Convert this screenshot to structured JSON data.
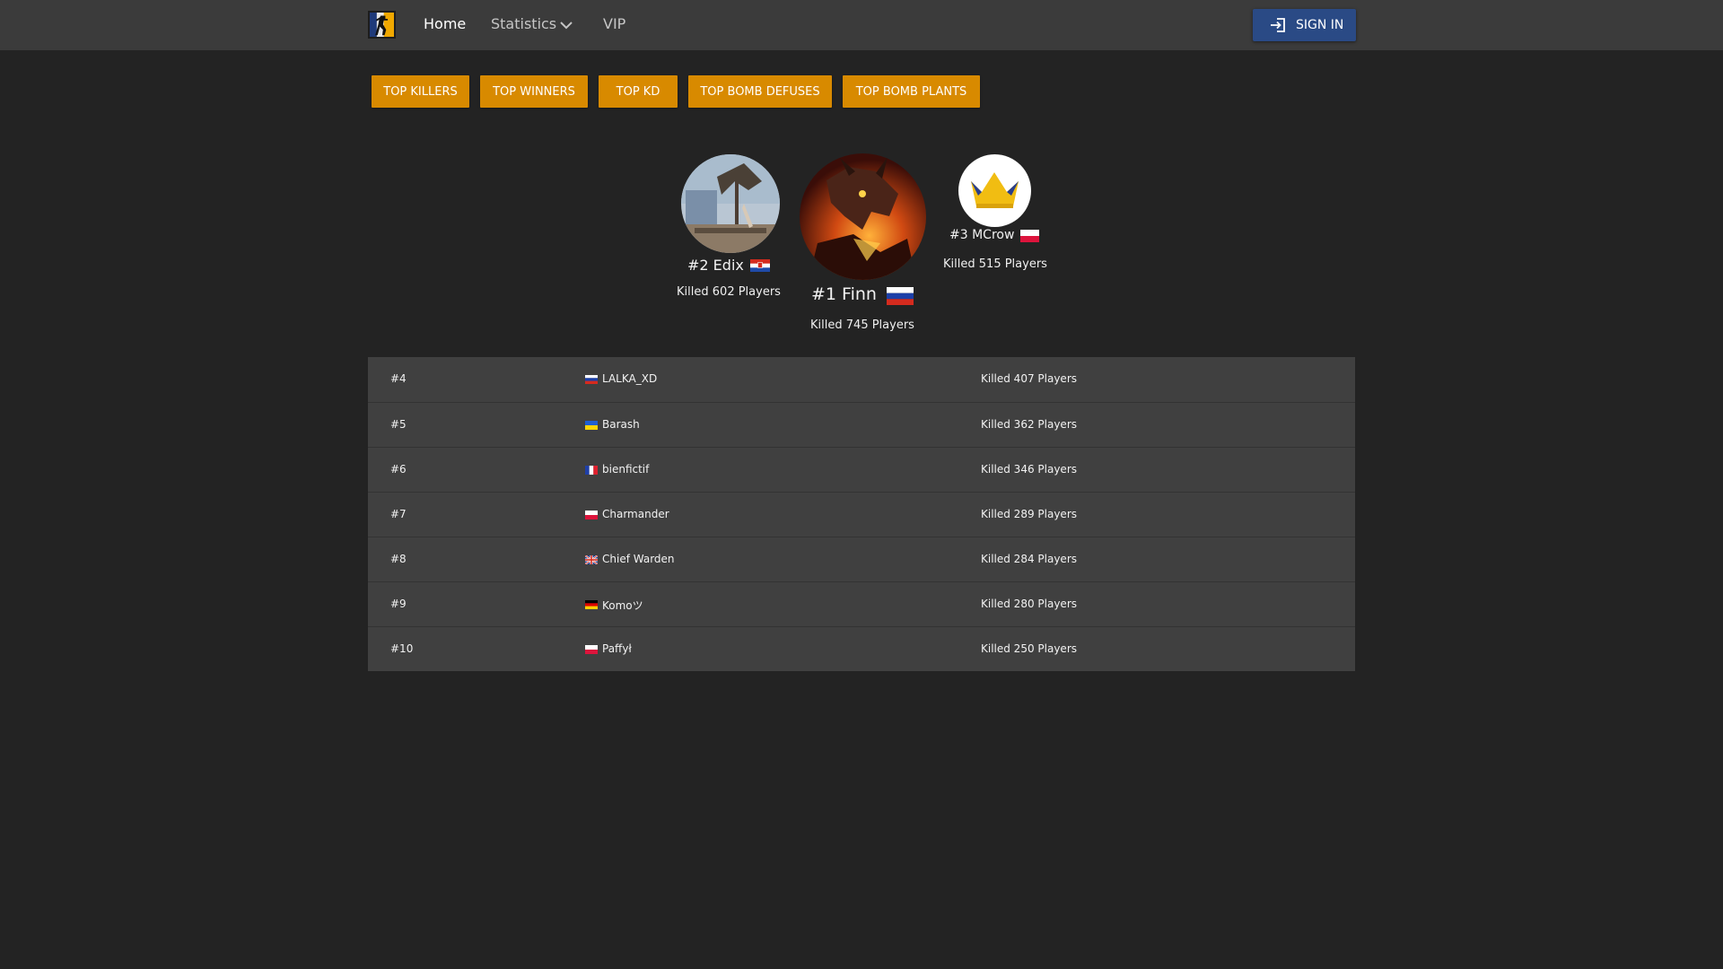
{
  "nav": {
    "home_label": "Home",
    "statistics_label": "Statistics",
    "vip_label": "VIP",
    "sign_in_label": "SIGN IN"
  },
  "filters": [
    "TOP KILLERS",
    "TOP WINNERS",
    "TOP KD",
    "TOP BOMB DEFUSES",
    "TOP BOMB PLANTS"
  ],
  "podium": {
    "first": {
      "title": "#1 Finn",
      "kills": "Killed 745 Players",
      "flag": "russia-flag"
    },
    "second": {
      "title": "#2 Edix",
      "kills": "Killed 602 Players",
      "flag": "croatia-flag"
    },
    "third": {
      "title": "#3 MCrow",
      "kills": "Killed 515 Players",
      "flag": "poland-flag"
    }
  },
  "table": {
    "rows": [
      {
        "rank": "#4",
        "name": "LALKA_XD",
        "kills": "Killed 407 Players",
        "flag": "russia-flag"
      },
      {
        "rank": "#5",
        "name": "Barash",
        "kills": "Killed 362 Players",
        "flag": "ukraine-flag"
      },
      {
        "rank": "#6",
        "name": "bienfictif",
        "kills": "Killed 346 Players",
        "flag": "france-flag"
      },
      {
        "rank": "#7",
        "name": "Charmander",
        "kills": "Killed 289 Players",
        "flag": "poland-flag"
      },
      {
        "rank": "#8",
        "name": "Chief Warden",
        "kills": "Killed 284 Players",
        "flag": "uk-flag"
      },
      {
        "rank": "#9",
        "name": "Komoツ",
        "kills": "Killed 280 Players",
        "flag": "germany-flag"
      },
      {
        "rank": "#10",
        "name": "Paffył",
        "kills": "Killed 250 Players",
        "flag": "poland-flag"
      }
    ]
  },
  "colors": {
    "background": "#232323",
    "topbar": "#3b3b3b",
    "accent_button": "#d88a00",
    "sign_in_button": "#2a4a85",
    "table_background": "#404040"
  }
}
